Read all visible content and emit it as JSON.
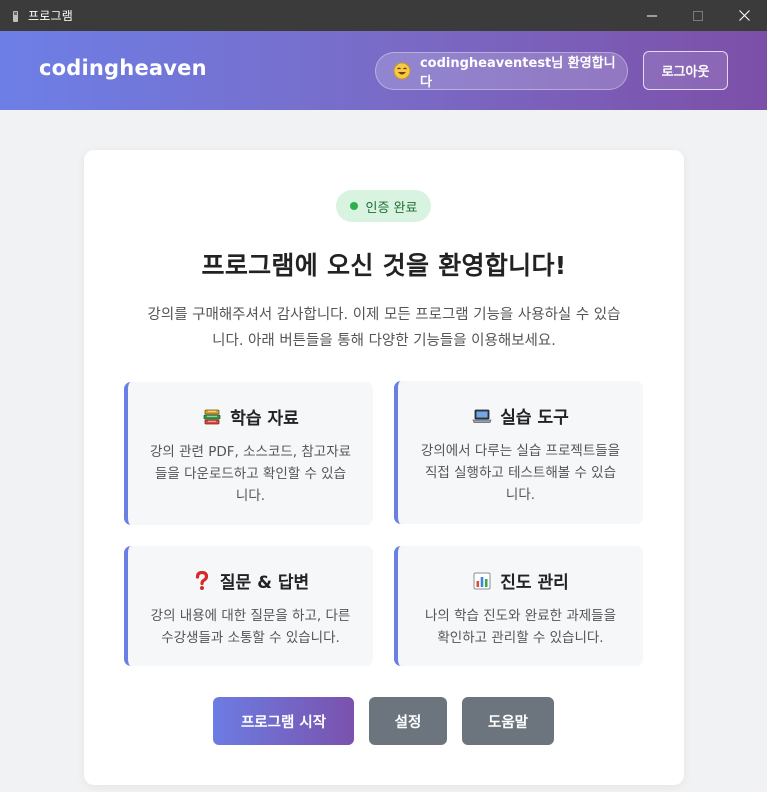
{
  "window": {
    "title": "프로그램"
  },
  "header": {
    "brand": "codingheaven",
    "welcome_text": "codingheaventest님 환영합니다",
    "logout_label": "로그아웃"
  },
  "main": {
    "auth_badge": "인증 완료",
    "title": "프로그램에 오신 것을 환영합니다!",
    "intro_line1": "강의를 구매해주셔서 감사합니다. 이제 모든 프로그램 기능을 사용하실 수 있습",
    "intro_line2": "니다. 아래 버튼들을 통해 다양한 기능들을 이용해보세요.",
    "features": [
      {
        "icon": "books-icon",
        "title": "학습 자료",
        "desc_line1": "강의 관련 PDF, 소스코드, 참고자료",
        "desc_line2": "들을 다운로드하고 확인할 수 있습",
        "desc_line3": "니다."
      },
      {
        "icon": "laptop-icon",
        "title": "실습 도구",
        "desc_line1": "강의에서 다루는 실습 프로젝트들을",
        "desc_line2": "직접 실행하고 테스트해볼 수 있습",
        "desc_line3": "니다."
      },
      {
        "icon": "question-mark-icon",
        "title": "질문 & 답변",
        "desc_line1": "강의 내용에 대한 질문을 하고, 다른",
        "desc_line2": "수강생들과 소통할 수 있습니다."
      },
      {
        "icon": "bar-chart-icon",
        "title": "진도 관리",
        "desc_line1": "나의 학습 진도와 완료한 과제들을",
        "desc_line2": "확인하고 관리할 수 있습니다."
      }
    ],
    "buttons": {
      "start": "프로그램 시작",
      "settings": "설정",
      "help": "도움말"
    }
  },
  "colors": {
    "accent": "#6a7fe4",
    "accent_purple": "#7a52ad",
    "success": "#2fae4e",
    "secondary_button": "#6c757d"
  }
}
